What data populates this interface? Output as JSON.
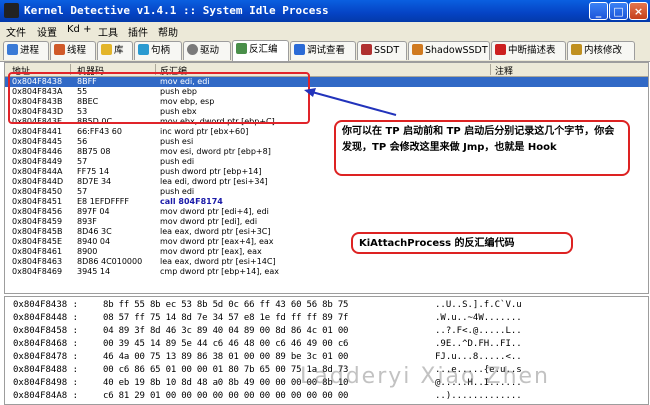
{
  "window": {
    "title": "Kernel Detective v1.4.1 :: System Idle Process",
    "btn_min": "_",
    "btn_max": "□",
    "btn_close": "×"
  },
  "menu": [
    "文件",
    "设置",
    "Kd +",
    "工具",
    "插件",
    "帮助"
  ],
  "tabs": [
    {
      "label": "进程",
      "color": "#3a7ad6"
    },
    {
      "label": "线程",
      "color": "#d05a2a"
    },
    {
      "label": "库",
      "color": "#e3b52a"
    },
    {
      "label": "句柄",
      "color": "#2a9ad0"
    },
    {
      "label": "驱动",
      "color": "#7a7a7a"
    },
    {
      "label": "反汇编",
      "color": "#4a8f4a"
    },
    {
      "label": "调试查看",
      "color": "#2a6ad6"
    },
    {
      "label": "SSDT",
      "color": "#b03030"
    },
    {
      "label": "ShadowSSDT",
      "color": "#d07a20"
    },
    {
      "label": "中断描述表",
      "color": "#cc2020"
    },
    {
      "label": "内核修改",
      "color": "#c09020"
    }
  ],
  "grid_headers": [
    "地址",
    "机器码",
    "反汇编",
    "注释"
  ],
  "rows": [
    {
      "addr": "0x804F8438",
      "code": "8BFF",
      "asm": "mov edi, edi",
      "sel": true
    },
    {
      "addr": "0x804F843A",
      "code": "55",
      "asm": "push ebp"
    },
    {
      "addr": "0x804F843B",
      "code": "8BEC",
      "asm": "mov ebp, esp"
    },
    {
      "addr": "0x804F843D",
      "code": "53",
      "asm": "push ebx"
    },
    {
      "addr": "0x804F843E",
      "code": "8B5D 0C",
      "asm": "mov ebx, dword ptr [ebp+C]"
    },
    {
      "addr": "0x804F8441",
      "code": "66:FF43 60",
      "asm": "inc word ptr [ebx+60]"
    },
    {
      "addr": "0x804F8445",
      "code": "56",
      "asm": "push esi"
    },
    {
      "addr": "0x804F8446",
      "code": "8B75 08",
      "asm": "mov esi, dword ptr [ebp+8]"
    },
    {
      "addr": "0x804F8449",
      "code": "57",
      "asm": "push edi"
    },
    {
      "addr": "0x804F844A",
      "code": "FF75 14",
      "asm": "push dword ptr [ebp+14]"
    },
    {
      "addr": "0x804F844D",
      "code": "8D7E 34",
      "asm": "lea edi, dword ptr [esi+34]"
    },
    {
      "addr": "0x804F8450",
      "code": "57",
      "asm": "push edi"
    },
    {
      "addr": "0x804F8451",
      "code": "E8 1EFDFFFF",
      "asm": "call 804F8174",
      "call": true
    },
    {
      "addr": "0x804F8456",
      "code": "897F 04",
      "asm": "mov dword ptr [edi+4], edi"
    },
    {
      "addr": "0x804F8459",
      "code": "893F",
      "asm": "mov dword ptr [edi], edi"
    },
    {
      "addr": "0x804F845B",
      "code": "8D46 3C",
      "asm": "lea eax, dword ptr [esi+3C]"
    },
    {
      "addr": "0x804F845E",
      "code": "8940 04",
      "asm": "mov dword ptr [eax+4], eax"
    },
    {
      "addr": "0x804F8461",
      "code": "8900",
      "asm": "mov dword ptr [eax], eax"
    },
    {
      "addr": "0x804F8463",
      "code": "8D86 4C010000",
      "asm": "lea eax, dword ptr [esi+14C]"
    },
    {
      "addr": "0x804F8469",
      "code": "3945 14",
      "asm": "cmp dword ptr [ebp+14], eax"
    }
  ],
  "callouts": {
    "hook": "你可以在 TP 启动前和 TP 启动后分别记录这几个字节，你会发现，TP 会修改这里来做 Jmp，也就是 Hook",
    "func": "KiAttachProcess 的反汇编代码"
  },
  "hex_rows": [
    {
      "addr": "0x804F8438 :",
      "bytes": "8b ff 55 8b ec 53 8b 5d 0c 66 ff 43 60 56 8b 75",
      "ascii": "..U..S.].f.C`V.u"
    },
    {
      "addr": "0x804F8448 :",
      "bytes": "08 57 ff 75 14 8d 7e 34 57 e8 1e fd ff ff 89 7f",
      "ascii": ".W.u..~4W......."
    },
    {
      "addr": "0x804F8458 :",
      "bytes": "04 89 3f 8d 46 3c 89 40 04 89 00 8d 86 4c 01 00",
      "ascii": "..?.F<.@.....L.."
    },
    {
      "addr": "0x804F8468 :",
      "bytes": "00 39 45 14 89 5e 44 c6 46 48 00 c6 46 49 00 c6",
      "ascii": ".9E..^D.FH..FI.."
    },
    {
      "addr": "0x804F8478 :",
      "bytes": "46 4a 00 75 13 89 86 38 01 00 00 89 be 3c 01 00",
      "ascii": "FJ.u...8.....<.."
    },
    {
      "addr": "0x804F8488 :",
      "bytes": "00 c6 86 65 01 00 00 01 80 7b 65 00 75 1a 8d 73",
      "ascii": "...e.....{e.u..s"
    },
    {
      "addr": "0x804F8498 :",
      "bytes": "40 eb 19 8b 10 8d 48 a0 8b 49 00 00 00 00 8b 10",
      "ascii": "@.....H..I......"
    },
    {
      "addr": "0x804F84A8 :",
      "bytes": "c6 81 29 01 00 00 00 00 00 00 00 00 00 00 00 00",
      "ascii": "..)............."
    }
  ],
  "watermark": "Ladderyi Xiao Zhen"
}
